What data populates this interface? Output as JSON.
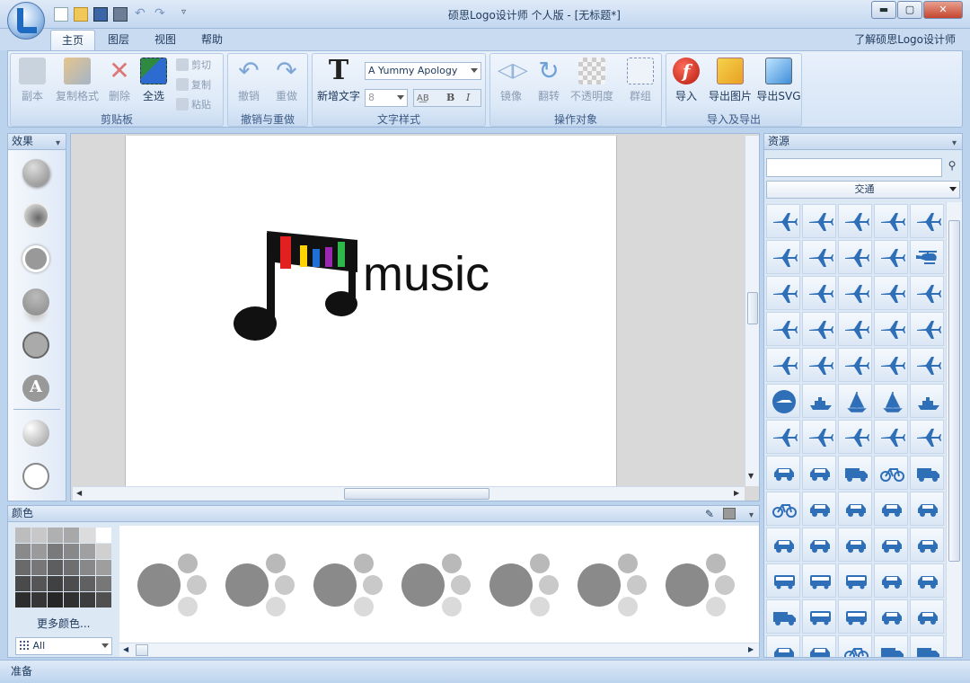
{
  "window": {
    "title": "硕思Logo设计师 个人版 - [无标题*]",
    "min_label": "▬",
    "max_label": "▢",
    "close_label": "✕"
  },
  "tabs": [
    {
      "label": "主页",
      "active": true
    },
    {
      "label": "图层",
      "active": false
    },
    {
      "label": "视图",
      "active": false
    },
    {
      "label": "帮助",
      "active": false
    }
  ],
  "help_link": "了解硕思Logo设计师",
  "ribbon": {
    "clipboard": {
      "label": "剪贴板",
      "copy_doc": "副本",
      "format_painter": "复制格式",
      "delete": "删除",
      "select_all": "全选",
      "cut": "剪切",
      "copy": "复制",
      "paste": "粘贴"
    },
    "undo_group": {
      "label": "撤销与重做",
      "undo": "撤销",
      "redo": "重做"
    },
    "text_style": {
      "label": "文字样式",
      "new_text": "新增文字",
      "font": "A Yummy Apology",
      "size": "8",
      "bold": "B",
      "italic": "I"
    },
    "ops": {
      "label": "操作对象",
      "mirror": "镜像",
      "rotate": "翻转",
      "opacity": "不透明度",
      "group": "群组"
    },
    "import_export": {
      "label": "导入及导出",
      "import": "导入",
      "export_image": "导出图片",
      "export_svg": "导出SVG"
    }
  },
  "effects_panel": {
    "title": "效果"
  },
  "canvas": {
    "logo_text": "music",
    "bar_colors": [
      "#e22020",
      "#ffd400",
      "#1e6fd6",
      "#9b27b0",
      "#2fb84a"
    ]
  },
  "resources_panel": {
    "title": "资源",
    "search_placeholder": "",
    "category": "交通"
  },
  "colors_panel": {
    "title": "颜色",
    "more_colors": "更多颜色...",
    "filter": "All"
  },
  "status": {
    "text": "准备"
  }
}
